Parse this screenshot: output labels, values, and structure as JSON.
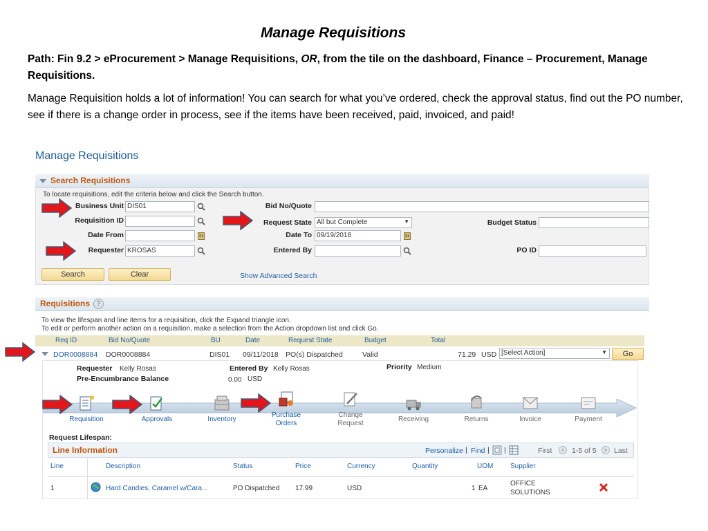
{
  "slide": {
    "title": "Manage Requisitions",
    "path_prefix": "Path:  Fin 9.2 > eProcurement > Manage Requisitions, ",
    "path_or": "OR",
    "path_suffix": ", from the tile on the dashboard, Finance – Procurement, Manage Requisitions.",
    "description": "Manage Requisition holds a lot of information!  You can search for what you’ve ordered, check the approval status, find out the PO number, see if there is a change order in process, see if the items have been received, paid, invoiced, and paid!"
  },
  "page": {
    "title": "Manage Requisitions"
  },
  "search": {
    "section_title": "Search Requisitions",
    "instructions": "To locate requisitions, edit the criteria below and click the Search button.",
    "business_unit_label": "Business Unit",
    "business_unit_value": "DIS01",
    "requisition_id_label": "Requisition ID",
    "requisition_id_value": "",
    "date_from_label": "Date From",
    "date_from_value": "",
    "requester_label": "Requester",
    "requester_value": "KROSAS",
    "bid_label": "Bid No/Quote",
    "bid_value": "",
    "request_state_label": "Request State",
    "request_state_value": "All but Complete",
    "date_to_label": "Date To",
    "date_to_value": "09/19/2018",
    "entered_by_label": "Entered By",
    "entered_by_value": "",
    "budget_status_label": "Budget Status",
    "budget_status_value": "",
    "po_id_label": "PO ID",
    "po_id_value": "",
    "search_button": "Search",
    "clear_button": "Clear",
    "advanced_link": "Show Advanced Search"
  },
  "requisitions": {
    "section_title": "Requisitions",
    "help_glyph": "?",
    "instruction_1": "To view the lifespan and line items for a requisition, click the Expand triangle icon.",
    "instruction_2": "To edit or perform another action on a requisition, make a selection from the Action dropdown list and click Go.",
    "headers": {
      "req_id": "Req ID",
      "bid": "Bid No/Quote",
      "bu": "BU",
      "date": "Date",
      "state": "Request State",
      "budget": "Budget",
      "total": "Total"
    },
    "row": {
      "req_id": "DOR0008884",
      "bid": "DOR0008884",
      "bu": "DIS01",
      "date": "09/11/2018",
      "state": "PO(s) Dispatched",
      "budget": "Valid",
      "total": "71.29",
      "currency": "USD",
      "action": "[Select Action]",
      "go_button": "Go"
    },
    "details": {
      "requester_label": "Requester",
      "requester_value": "Kelly Rosas",
      "entered_by_label": "Entered By",
      "entered_by_value": "Kelly Rosas",
      "priority_label": "Priority",
      "priority_value": "Medium",
      "pre_enc_label": "Pre-Encumbrance Balance",
      "pre_enc_value": "0.00",
      "pre_enc_currency": "USD"
    },
    "lifecycle": [
      "Requisition",
      "Approvals",
      "Inventory",
      "Purchase Orders",
      "Change Request",
      "Receiving",
      "Returns",
      "Invoice",
      "Payment"
    ],
    "lifespan_label": "Request Lifespan:",
    "line_info": {
      "title": "Line Information",
      "personalize": "Personalize",
      "find": "Find",
      "first": "First",
      "range": "1-5 of 5",
      "last": "Last",
      "columns": [
        "Line",
        "Description",
        "Status",
        "Price",
        "Currency",
        "Quantity",
        "UOM",
        "Supplier"
      ],
      "row": {
        "line": "1",
        "description": "Hard Candies, Caramel w/Cara...",
        "status": "PO Dispatched",
        "price": "17.99",
        "currency": "USD",
        "quantity": "1",
        "uom": "EA",
        "supplier_1": "OFFICE",
        "supplier_2": "SOLUTIONS"
      }
    }
  }
}
